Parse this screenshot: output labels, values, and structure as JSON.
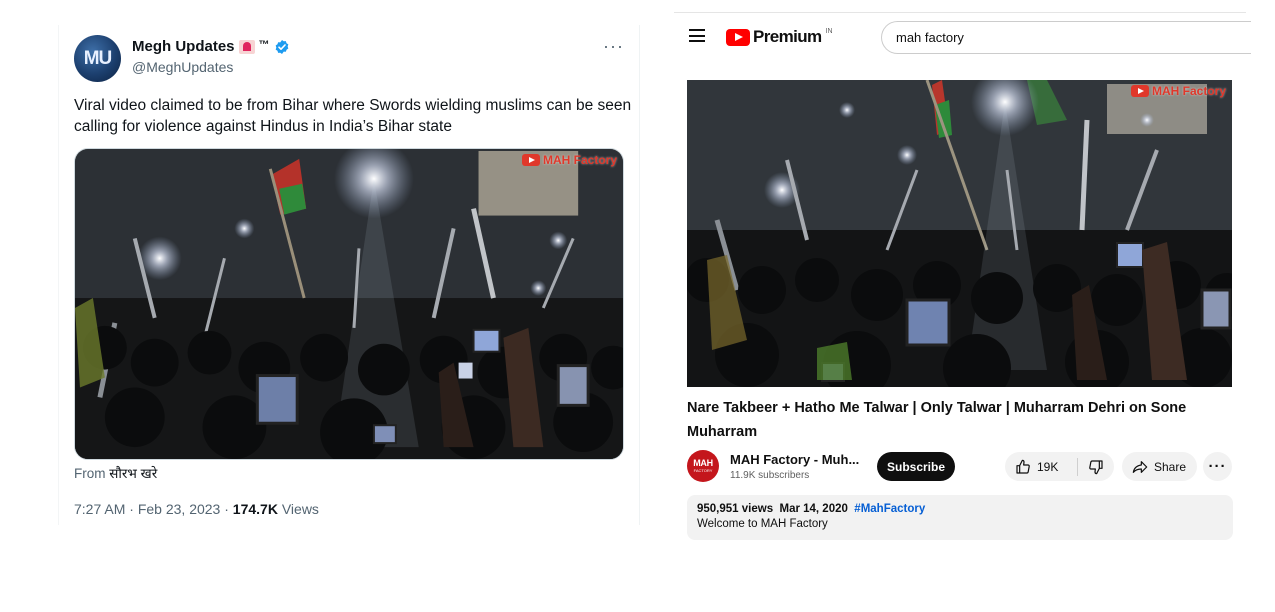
{
  "tweet": {
    "avatar_initials": "MU",
    "display_name": "Megh Updates",
    "name_suffix": "™",
    "handle": "@MeghUpdates",
    "more_icon": "more-horizontal-icon",
    "text": "Viral video claimed to be from Bihar where Swords wielding muslims can be seen calling for violence against Hindus in India’s Bihar state",
    "media_watermark": "MAH Factory",
    "media_from_prefix": "From",
    "media_from_author": "सौरभ खरे",
    "time": "7:27 AM",
    "separator": "·",
    "date": "Feb 23, 2023",
    "views_count": "174.7K",
    "views_label": "Views",
    "verified_color": "#1d9bf0"
  },
  "youtube": {
    "logo_text": "Premium",
    "region": "IN",
    "search_value": "mah factory",
    "player_watermark": "MAH Factory",
    "video_title": "Nare Takbeer + Hatho Me Talwar | Only Talwar | Muharram Dehri on Sone Muharram",
    "channel_avatar_text": "MAH",
    "channel_avatar_sub": "FACTORY",
    "channel_name": "MAH Factory - Muh...",
    "subscribers": "11.9K subscribers",
    "subscribe_label": "Subscribe",
    "likes": "19K",
    "share_label": "Share",
    "description": {
      "views": "950,951 views",
      "date": "Mar 14, 2020",
      "hashtag": "#MahFactory",
      "text": "Welcome to MAH Factory"
    },
    "brand_red": "#ff0000",
    "link_blue": "#065fd4"
  }
}
